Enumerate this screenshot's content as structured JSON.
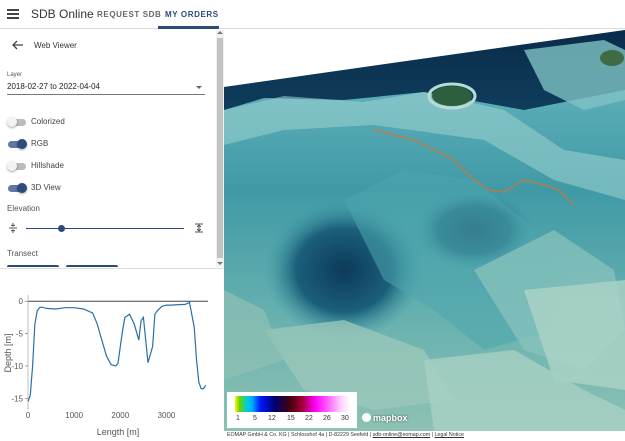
{
  "header": {
    "app_title": "SDB Online",
    "tabs": [
      {
        "label": "REQUEST SDB",
        "active": false
      },
      {
        "label": "MY ORDERS",
        "active": true
      }
    ]
  },
  "panel": {
    "title": "Web Viewer",
    "layer": {
      "label": "Layer",
      "value": "2018-02-27 to 2022-04-04"
    },
    "toggles": [
      {
        "label": "Colorized",
        "on": false
      },
      {
        "label": "RGB",
        "on": true
      },
      {
        "label": "Hillshade",
        "on": false
      },
      {
        "label": "3D View",
        "on": true
      }
    ],
    "elevation": {
      "label": "Elevation",
      "level": 0.2
    },
    "transect": {
      "label": "Transect"
    }
  },
  "chart_data": {
    "type": "line",
    "xlabel": "Length [m]",
    "ylabel": "Depth [m]",
    "xlim": [
      0,
      3900
    ],
    "ylim": [
      -16.5,
      0.5
    ],
    "xticks": [
      0,
      1000,
      2000,
      3000
    ],
    "yticks": [
      0,
      -5,
      -10,
      -15
    ],
    "series": [
      {
        "x": [
          0,
          50,
          100,
          150,
          200,
          250,
          300,
          400,
          600,
          800,
          1000,
          1200,
          1400,
          1500,
          1600,
          1700,
          1800,
          1900,
          1950,
          2000,
          2050,
          2100,
          2200,
          2300,
          2400,
          2450,
          2500,
          2550,
          2600,
          2700,
          2750,
          2800,
          2900,
          3000,
          3100,
          3300,
          3400,
          3500,
          3600,
          3650,
          3700,
          3750,
          3800,
          3850
        ],
        "y": [
          -15.5,
          -14.5,
          -10,
          -3.5,
          -1.5,
          -1.0,
          -0.9,
          -1.1,
          -1.2,
          -1.0,
          -1.0,
          -1.2,
          -1.8,
          -3.5,
          -6.0,
          -8.5,
          -9.8,
          -10.0,
          -9.6,
          -7.0,
          -4.5,
          -2.5,
          -2.0,
          -3.5,
          -6.0,
          -3.0,
          -2.5,
          -6.0,
          -9.5,
          -7.0,
          -2.0,
          -1.5,
          -0.8,
          -0.6,
          -0.6,
          -0.5,
          -0.5,
          -0.2,
          -4.0,
          -9.0,
          -12.5,
          -13.5,
          -13.5,
          -13.0
        ]
      }
    ]
  },
  "legend": {
    "values": [
      "1",
      "5",
      "12",
      "15",
      "22",
      "26",
      "30"
    ]
  },
  "map_attribution": {
    "logo": "mapbox",
    "footer": "EOMAP GmbH & Co. KG | Schlosshof 4a | D-82229 Seefeld |",
    "email": "sdb-online@eomap.com",
    "legal": "Legal Notice"
  }
}
